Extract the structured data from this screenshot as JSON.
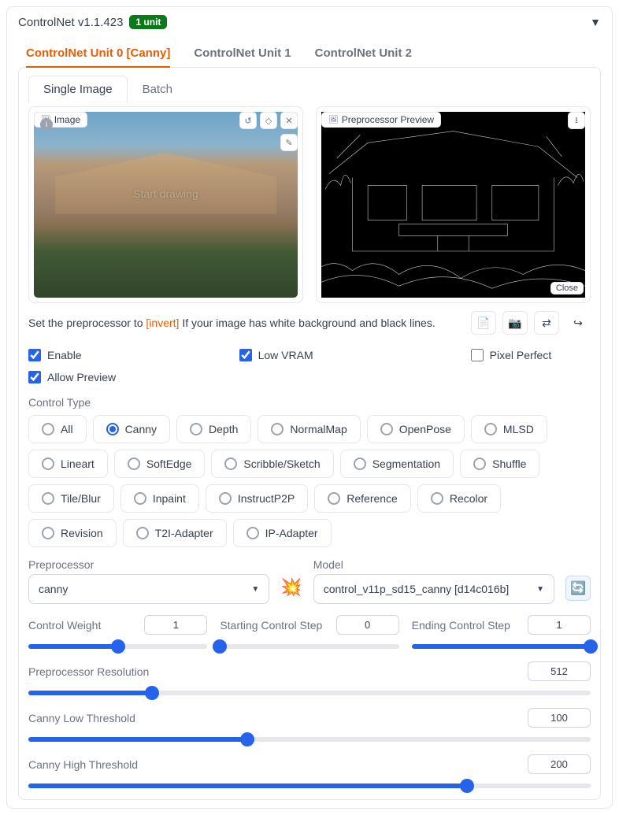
{
  "header": {
    "title": "ControlNet v1.1.423",
    "badge": "1 unit"
  },
  "tabs": [
    "ControlNet Unit 0 [Canny]",
    "ControlNet Unit 1",
    "ControlNet Unit 2"
  ],
  "sub_tabs": [
    "Single Image",
    "Batch"
  ],
  "image_pane": {
    "label": "Image",
    "overlay": "Start drawing"
  },
  "preview_pane": {
    "label": "Preprocessor Preview",
    "close": "Close"
  },
  "hint": {
    "prefix": "Set the preprocessor to ",
    "link": "[invert]",
    "suffix": " If your image has white background and black lines."
  },
  "checks": {
    "enable": "Enable",
    "low_vram": "Low VRAM",
    "pixel_perfect": "Pixel Perfect",
    "allow_preview": "Allow Preview"
  },
  "control_type": {
    "label": "Control Type",
    "options": [
      "All",
      "Canny",
      "Depth",
      "NormalMap",
      "OpenPose",
      "MLSD",
      "Lineart",
      "SoftEdge",
      "Scribble/Sketch",
      "Segmentation",
      "Shuffle",
      "Tile/Blur",
      "Inpaint",
      "InstructP2P",
      "Reference",
      "Recolor",
      "Revision",
      "T2I-Adapter",
      "IP-Adapter"
    ],
    "selected": "Canny"
  },
  "preprocessor": {
    "label": "Preprocessor",
    "value": "canny"
  },
  "model": {
    "label": "Model",
    "value": "control_v11p_sd15_canny [d14c016b]"
  },
  "sliders": {
    "control_weight": {
      "label": "Control Weight",
      "value": "1",
      "pct": 50
    },
    "start_step": {
      "label": "Starting Control Step",
      "value": "0",
      "pct": 0
    },
    "end_step": {
      "label": "Ending Control Step",
      "value": "1",
      "pct": 100
    },
    "pp_res": {
      "label": "Preprocessor Resolution",
      "value": "512",
      "pct": 22
    },
    "canny_low": {
      "label": "Canny Low Threshold",
      "value": "100",
      "pct": 39
    },
    "canny_high": {
      "label": "Canny High Threshold",
      "value": "200",
      "pct": 78
    }
  }
}
